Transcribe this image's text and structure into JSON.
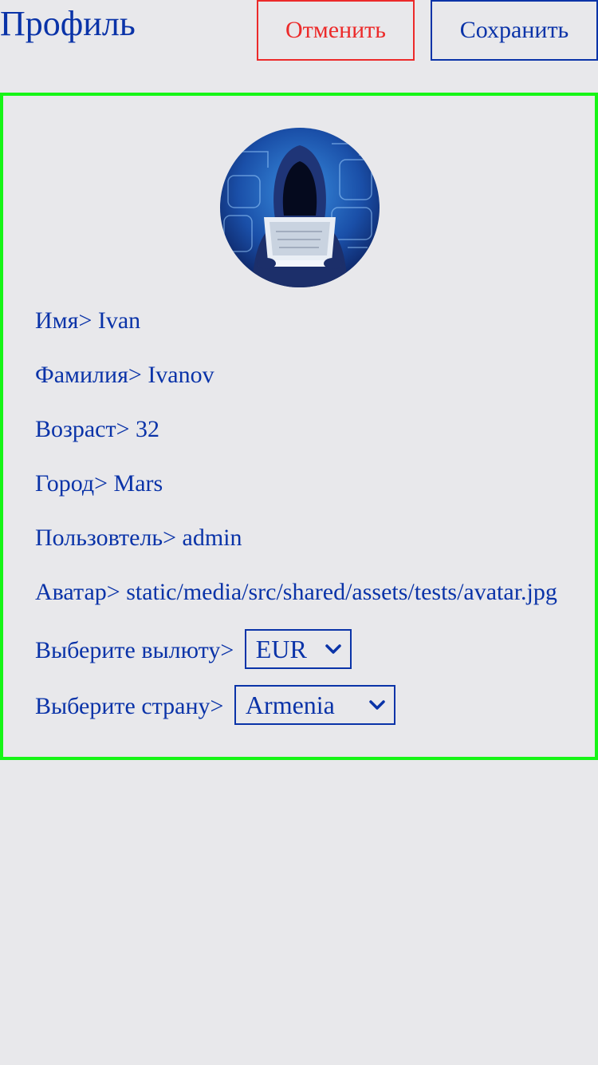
{
  "header": {
    "title": "Профиль",
    "cancel_label": "Отменить",
    "save_label": "Сохранить"
  },
  "profile": {
    "avatar_icon": "hacker-avatar",
    "fields": [
      {
        "label": "Имя>",
        "value": "Ivan"
      },
      {
        "label": "Фамилия>",
        "value": "Ivanov"
      },
      {
        "label": "Возраст>",
        "value": "32"
      },
      {
        "label": "Город>",
        "value": "Mars"
      },
      {
        "label": "Пользовтель>",
        "value": "admin"
      },
      {
        "label": "Аватар>",
        "value": "static/media/src/shared/assets/tests/avatar.jpg"
      }
    ],
    "currency": {
      "label": "Выберите вылюту>",
      "selected": "EUR"
    },
    "country": {
      "label": "Выберите страну>",
      "selected": "Armenia"
    }
  },
  "colors": {
    "background": "#e8e8eb",
    "primary": "#0a33a8",
    "danger": "#ec2a2a",
    "card_border": "#16f516"
  }
}
